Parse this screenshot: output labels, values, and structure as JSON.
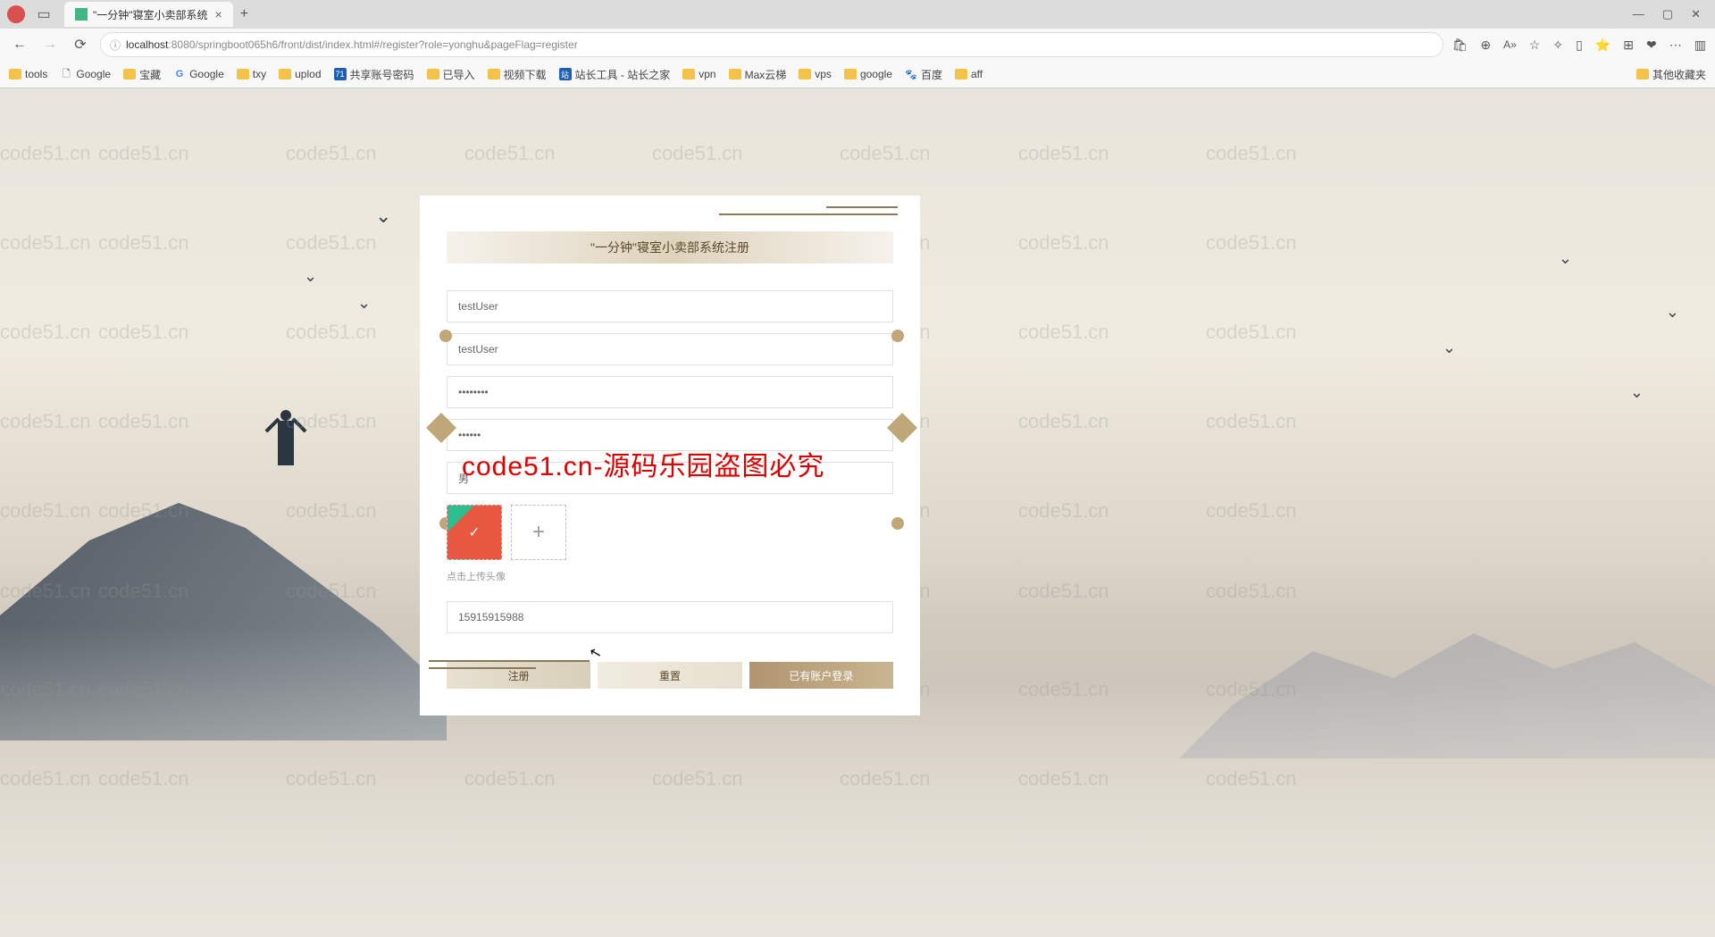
{
  "browser": {
    "tab_title": "\"一分钟\"寝室小卖部系统",
    "url_host": "localhost",
    "url_port": ":8080",
    "url_path": "/springboot065h6/front/dist/index.html#/register?role=yonghu&pageFlag=register"
  },
  "bookmarks": [
    {
      "label": "tools",
      "type": "folder"
    },
    {
      "label": "Google",
      "type": "page"
    },
    {
      "label": "宝藏",
      "type": "folder"
    },
    {
      "label": "Google",
      "type": "google"
    },
    {
      "label": "txy",
      "type": "folder"
    },
    {
      "label": "uplod",
      "type": "folder"
    },
    {
      "label": "共享账号密码",
      "type": "page"
    },
    {
      "label": "已导入",
      "type": "folder"
    },
    {
      "label": "视频下载",
      "type": "folder"
    },
    {
      "label": "站长工具 - 站长之家",
      "type": "page"
    },
    {
      "label": "vpn",
      "type": "folder"
    },
    {
      "label": "Max云梯",
      "type": "folder"
    },
    {
      "label": "vps",
      "type": "folder"
    },
    {
      "label": "google",
      "type": "folder"
    },
    {
      "label": "百度",
      "type": "baidu"
    },
    {
      "label": "aff",
      "type": "folder"
    }
  ],
  "bookmarks_other": "其他收藏夹",
  "form": {
    "title": "\"一分钟\"寝室小卖部系统注册",
    "username": "testUser",
    "nickname": "testUser",
    "password": "••••••••",
    "confirm_password": "••••••",
    "gender": "男",
    "upload_hint": "点击上传头像",
    "phone": "15915915988",
    "btn_register": "注册",
    "btn_reset": "重置",
    "btn_login": "已有账户登录"
  },
  "watermark_text": "code51.cn",
  "overlay": "code51.cn-源码乐园盗图必究"
}
